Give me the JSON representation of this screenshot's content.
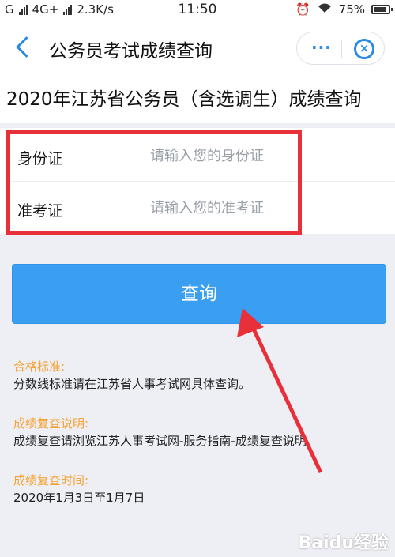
{
  "status_bar": {
    "carrier1": "G",
    "carrier2": "4G+",
    "speed": "2.3K/s",
    "time": "11:50",
    "battery": "75%",
    "icons": [
      "alarm-icon",
      "wifi-icon",
      "battery-icon"
    ]
  },
  "header": {
    "title": "公务员考试成绩查询",
    "more_label": "···",
    "close_label": "×"
  },
  "exam_title": "2020年江苏省公务员（含选调生）成绩查询",
  "form": {
    "id_label": "身份证",
    "id_placeholder": "请输入您的身份证",
    "ticket_label": "准考证",
    "ticket_placeholder": "请输入您的准考证"
  },
  "query_button": "查询",
  "info": [
    {
      "heading": "合格标准:",
      "text": "分数线标准请在江苏省人事考试网具体查询。"
    },
    {
      "heading": "成绩复查说明:",
      "text": "成绩复查请浏览江苏人事考试网-服务指南-成绩复查说明"
    },
    {
      "heading": "成绩复查时间:",
      "text": "2020年1月3日至1月7日"
    }
  ],
  "watermark": "Baidu经验",
  "colors": {
    "accent": "#2b8ae6",
    "button": "#3a9ff0",
    "highlight": "#e8303a",
    "info_heading": "#f4a233"
  }
}
